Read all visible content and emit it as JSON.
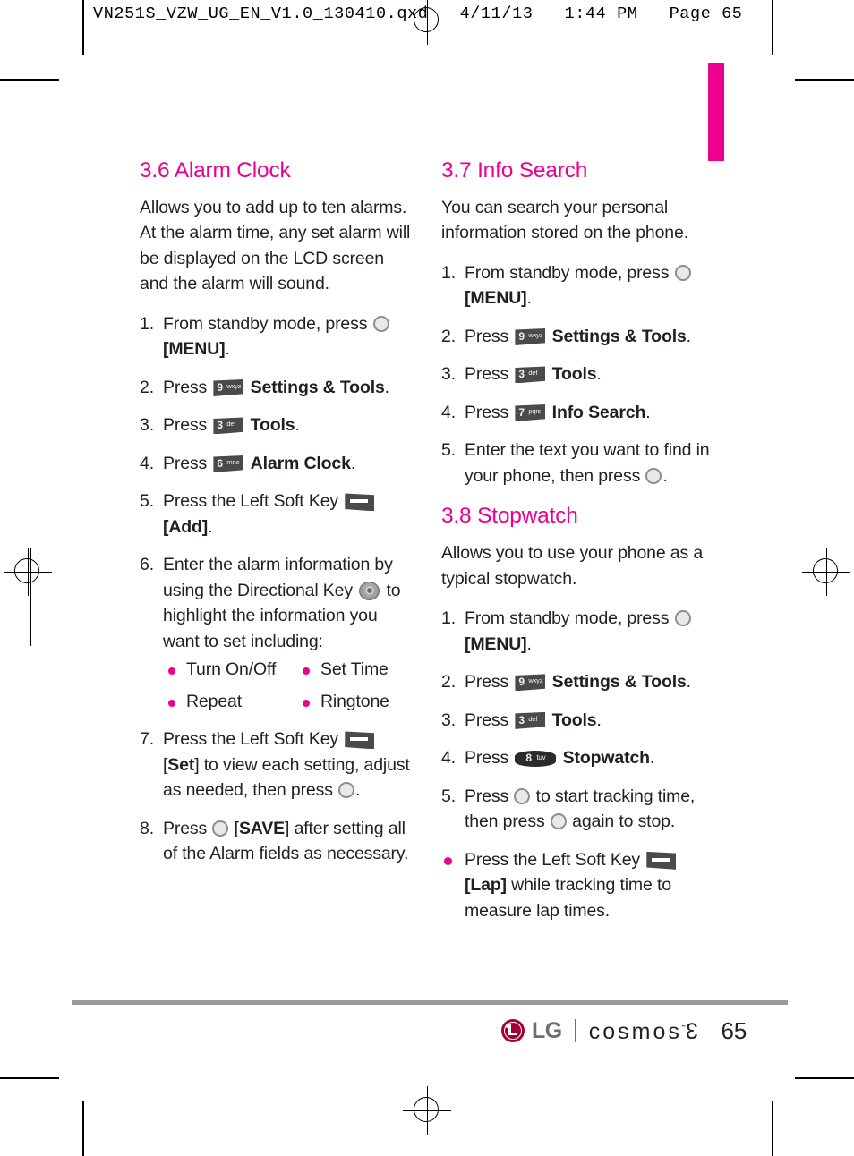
{
  "print_marks": {
    "slug": "VN251S_VZW_UG_EN_V1.0_130410.qxd   4/11/13   1:44 PM   Page 65"
  },
  "left_column": {
    "heading": "3.6 Alarm Clock",
    "intro": "Allows you to add up to ten alarms. At the alarm time, any set alarm will be displayed on the LCD screen and the alarm will sound.",
    "steps": [
      {
        "num": "1.",
        "pre": "From standby mode, press",
        "icon": "ok-key-icon",
        "post": "",
        "bold": "[MENU]",
        "tail": "."
      },
      {
        "num": "2.",
        "pre": "Press",
        "icon": "key-9-wxyz-icon",
        "bold": "Settings & Tools",
        "tail": "."
      },
      {
        "num": "3.",
        "pre": "Press",
        "icon": "key-3-def-icon",
        "bold": "Tools",
        "tail": "."
      },
      {
        "num": "4.",
        "pre": "Press",
        "icon": "key-6-mno-icon",
        "bold": "Alarm Clock",
        "tail": "."
      },
      {
        "num": "5.",
        "pre": "Press the Left Soft Key",
        "icon": "left-soft-key-icon",
        "bold": "[Add]",
        "tail": "."
      },
      {
        "num": "6.",
        "pre": "Enter the alarm information by using the Directional Key",
        "icon": "directional-key-icon",
        "post": "to highlight the information you want to set including:"
      },
      {
        "num": "7.",
        "pre": "Press the Left Soft Key",
        "icon": "left-soft-key-icon",
        "bold_open": "[",
        "bold": "Set",
        "bold_close": "]",
        "post": " to view each setting, adjust as needed, then press",
        "icon2": "ok-key-icon",
        "tail": "."
      },
      {
        "num": "8.",
        "pre": "Press",
        "icon": "ok-key-icon",
        "bold_open": "[",
        "bold": "SAVE",
        "bold_close": "]",
        "post": " after setting all of the Alarm fields as necessary."
      }
    ],
    "alarm_fields": [
      "Turn On/Off",
      "Set Time",
      "Repeat",
      "Ringtone"
    ]
  },
  "right_column": {
    "section_info_search": {
      "heading": "3.7 Info Search",
      "intro": "You can search your personal information stored on the phone.",
      "steps": [
        {
          "num": "1.",
          "pre": "From standby mode, press",
          "icon": "ok-key-icon",
          "bold": "[MENU]",
          "tail": "."
        },
        {
          "num": "2.",
          "pre": "Press",
          "icon": "key-9-wxyz-icon",
          "bold": "Settings & Tools",
          "tail": "."
        },
        {
          "num": "3.",
          "pre": "Press",
          "icon": "key-3-def-icon",
          "bold": "Tools",
          "tail": "."
        },
        {
          "num": "4.",
          "pre": "Press",
          "icon": "key-7-pqrs-icon",
          "bold": "Info Search",
          "tail": "."
        },
        {
          "num": "5.",
          "pre": "Enter the text you want to find in your phone, then press",
          "icon": "ok-key-icon",
          "tail": "."
        }
      ]
    },
    "section_stopwatch": {
      "heading": "3.8 Stopwatch",
      "intro": "Allows you to use your phone as a typical stopwatch.",
      "steps": [
        {
          "num": "1.",
          "pre": "From standby mode, press",
          "icon": "ok-key-icon",
          "bold": "[MENU]",
          "tail": "."
        },
        {
          "num": "2.",
          "pre": "Press",
          "icon": "key-9-wxyz-icon",
          "bold": "Settings & Tools",
          "tail": "."
        },
        {
          "num": "3.",
          "pre": "Press",
          "icon": "key-3-def-icon",
          "bold": "Tools",
          "tail": "."
        },
        {
          "num": "4.",
          "pre": "Press",
          "icon": "key-8-tuv-icon",
          "bold": "Stopwatch",
          "tail": "."
        },
        {
          "num": "5.",
          "pre": "Press",
          "icon": "ok-key-icon",
          "post": "to start tracking time, then press",
          "icon2": "ok-key-icon",
          "tail2": "again to stop."
        }
      ],
      "note": {
        "pre": "Press the Left Soft Key",
        "icon": "left-soft-key-icon",
        "bold": "[Lap]",
        "post": " while tracking time to measure lap times."
      }
    }
  },
  "keys": {
    "k9": {
      "number": "9",
      "letters": "wxyz"
    },
    "k3": {
      "number": "3",
      "letters": "def"
    },
    "k6": {
      "number": "6",
      "letters": "mno"
    },
    "k7": {
      "number": "7",
      "letters": "pqrs"
    },
    "k8": {
      "number": "8",
      "letters": "tuv"
    }
  },
  "footer": {
    "brand": "LG",
    "product": "cosmos",
    "trademark": "˜",
    "model": "3",
    "page_number": "65"
  },
  "colors": {
    "accent_magenta": "#ec008c",
    "lg_crimson": "#a50034",
    "body_text": "#231f20",
    "key_gray": "#4a4a4a"
  }
}
